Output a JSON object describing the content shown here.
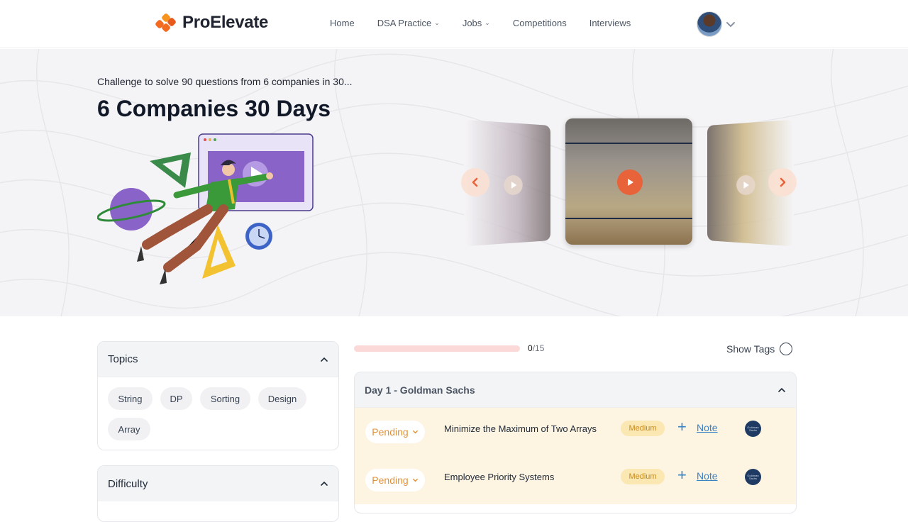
{
  "brand": {
    "name": "ProElevate",
    "accent": "#f26b21"
  },
  "nav": {
    "items": [
      {
        "label": "Home",
        "dropdown": false
      },
      {
        "label": "DSA Practice",
        "dropdown": true
      },
      {
        "label": "Jobs",
        "dropdown": true
      },
      {
        "label": "Competitions",
        "dropdown": false
      },
      {
        "label": "Interviews",
        "dropdown": false
      }
    ]
  },
  "hero": {
    "subtitle": "Challenge to solve 90 questions from 6 companies in 30...",
    "title": "6 Companies 30 Days"
  },
  "topics": {
    "heading": "Topics",
    "chips": [
      "String",
      "DP",
      "Sorting",
      "Design",
      "Array"
    ]
  },
  "difficulty": {
    "heading": "Difficulty"
  },
  "progress": {
    "solved": "0",
    "total": "/15",
    "fraction": 0
  },
  "show_tags": {
    "label": "Show Tags"
  },
  "day": {
    "heading": "Day 1 - Goldman Sachs",
    "questions": [
      {
        "status": "Pending",
        "title": "Minimize the Maximum of Two Arrays",
        "difficulty": "Medium",
        "note": "Note",
        "company_logo": "Goldman Sachs"
      },
      {
        "status": "Pending",
        "title": "Employee Priority Systems",
        "difficulty": "Medium",
        "note": "Note",
        "company_logo": "Goldman Sachs"
      }
    ]
  },
  "colors": {
    "pending": "#e0923a",
    "medium_badge": "#fbe7b1",
    "row_bg": "#fdf4e2",
    "link": "#3b82c4",
    "progress_track": "#fbd9d9"
  }
}
